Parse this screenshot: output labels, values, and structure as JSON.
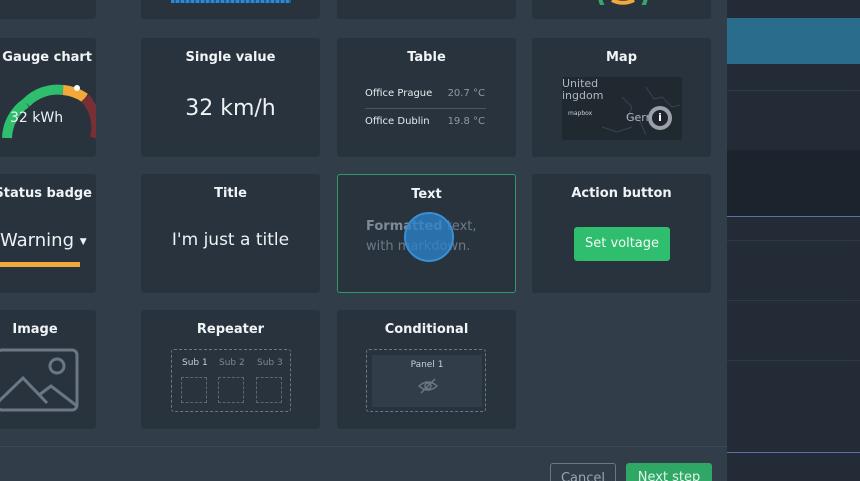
{
  "modal": {
    "cancel_label": "Cancel",
    "next_label": "Next step"
  },
  "widgets": {
    "gauge": {
      "title": "Gauge chart",
      "value": "32 kWh"
    },
    "single_value": {
      "title": "Single value",
      "value": "32 km/h"
    },
    "table": {
      "title": "Table",
      "rows": [
        {
          "name": "Office Prague",
          "value": "20.7 °C"
        },
        {
          "name": "Office Dublin",
          "value": "19.8 °C"
        }
      ]
    },
    "map": {
      "title": "Map",
      "label1": "United",
      "label2": "ingdom",
      "label3": "Germ",
      "logo": "mapbox",
      "info_icon": "info-icon"
    },
    "status_badge": {
      "title": "Status badge",
      "value": "Warning",
      "bar_color": "#f2a93b"
    },
    "title_widget": {
      "title": "Title",
      "value": "I'm just a title"
    },
    "text_widget": {
      "title": "Text",
      "bold": "Formatted",
      "line1_rest": " text,",
      "line2": "with markdown."
    },
    "action_button": {
      "title": "Action button",
      "button_label": "Set voltage"
    },
    "image": {
      "title": "Image",
      "icon": "image-placeholder-icon"
    },
    "repeater": {
      "title": "Repeater",
      "subs": [
        "Sub 1",
        "Sub 2",
        "Sub 3"
      ]
    },
    "conditional": {
      "title": "Conditional",
      "panel_label": "Panel 1",
      "icon": "eye-off-icon"
    }
  },
  "colors": {
    "accent_green": "#2fbd6e",
    "selected_border": "#2f9a66",
    "cursor": "#2b81c9"
  }
}
